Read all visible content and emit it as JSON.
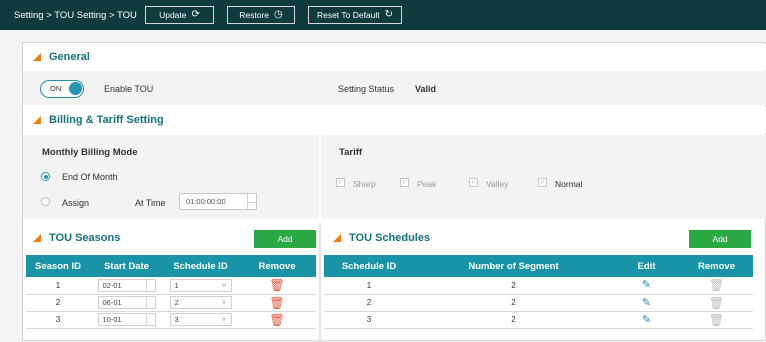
{
  "topbar": {
    "breadcrumb": "Setting > TOU Setting > TOU",
    "buttons": [
      {
        "label": "Update",
        "icon": "refresh-icon"
      },
      {
        "label": "Restore",
        "icon": "history-icon"
      },
      {
        "label": "Reset To Default",
        "icon": "reset-icon"
      }
    ]
  },
  "general": {
    "title": "General",
    "toggle_label": "ON",
    "enable_label": "Enable TOU",
    "status_label": "Setting Status",
    "status_value": "Valid"
  },
  "billing": {
    "title": "Billing & Tariff Setting",
    "mode_title": "Monthly Billing Mode",
    "option_end": "End Of Month",
    "option_assign": "Assign",
    "at_time_label": "At Time",
    "at_time_value": "01:00:00:00",
    "tariff_title": "Tariff",
    "tariffs": [
      {
        "label": "Sharp",
        "checked": true,
        "enabled": false
      },
      {
        "label": "Peak",
        "checked": true,
        "enabled": false
      },
      {
        "label": "Valley",
        "checked": true,
        "enabled": false
      },
      {
        "label": "Normal",
        "checked": true,
        "enabled": true
      }
    ]
  },
  "seasons": {
    "title": "TOU Seasons",
    "add_label": "Add",
    "columns": [
      "Season ID",
      "Start Date",
      "Schedule ID",
      "Remove"
    ],
    "rows": [
      {
        "season_id": "1",
        "start_date": "02-01",
        "schedule_id": "1"
      },
      {
        "season_id": "2",
        "start_date": "06-01",
        "schedule_id": "2"
      },
      {
        "season_id": "3",
        "start_date": "10-01",
        "schedule_id": "3"
      }
    ]
  },
  "schedules": {
    "title": "TOU Schedules",
    "add_label": "Add",
    "columns": [
      "Schedule ID",
      "Number of Segment",
      "Edit",
      "Remove"
    ],
    "rows": [
      {
        "schedule_id": "1",
        "segments": "2"
      },
      {
        "schedule_id": "2",
        "segments": "2"
      },
      {
        "schedule_id": "3",
        "segments": "2"
      }
    ]
  },
  "colors": {
    "topbar": "#0f3a3e",
    "accent": "#16707c",
    "table_header": "#1994a6",
    "add_button": "#29a844",
    "section_marker": "#f07c12"
  }
}
